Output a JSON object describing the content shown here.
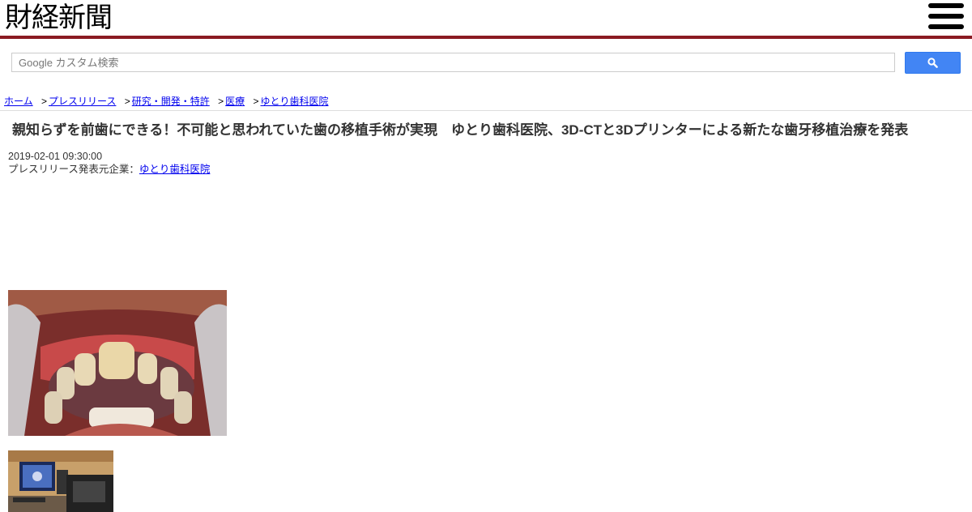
{
  "site": {
    "logo": "財経新聞"
  },
  "search": {
    "placeholder": "Google カスタム検索"
  },
  "breadcrumb": {
    "separator": ">",
    "items": [
      "ホーム",
      "プレスリリース",
      "研究・開発・特許",
      "医療",
      "ゆとり歯科医院"
    ]
  },
  "article": {
    "title": "親知らずを前歯にできる！不可能と思われていた歯の移植手術が実現　ゆとり歯科医院、3D-CTと3Dプリンターによる新たな歯牙移植治療を発表",
    "date": "2019-02-01 09:30:00",
    "company_label": "プレスリリース発表元企業：",
    "company_name": "ゆとり歯科医院"
  },
  "colors": {
    "header_rule": "#8b1a22",
    "search_button": "#4285f4",
    "link": "#0000ee"
  },
  "icons": {
    "menu": "hamburger-menu-icon",
    "search": "magnifier-icon"
  }
}
